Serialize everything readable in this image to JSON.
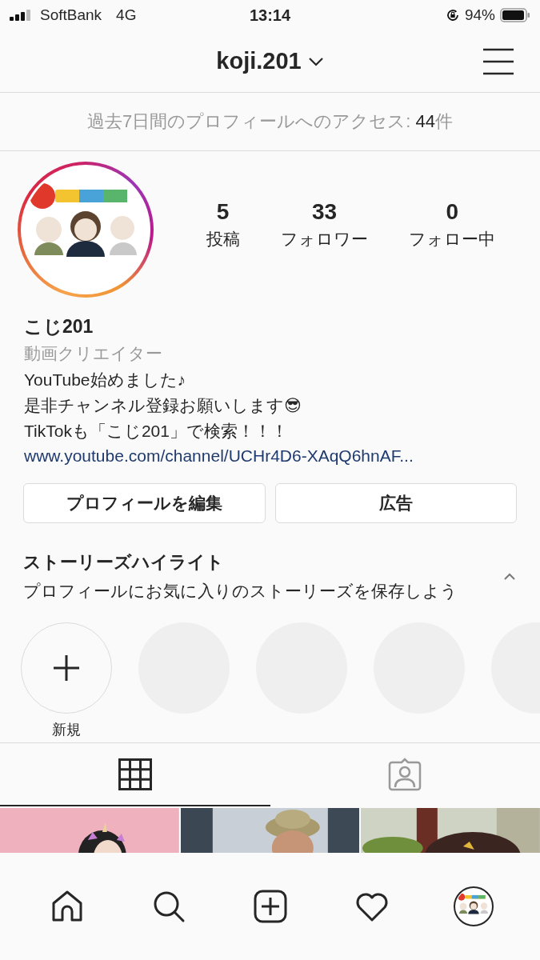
{
  "status_bar": {
    "carrier": "SoftBank",
    "network": "4G",
    "time": "13:14",
    "battery": "94%"
  },
  "header": {
    "username": "koji.201"
  },
  "access_banner": {
    "label": "過去7日間のプロフィールへのアクセス: ",
    "count": "44",
    "unit": "件"
  },
  "profile": {
    "stats": [
      {
        "value": "5",
        "label": "投稿"
      },
      {
        "value": "33",
        "label": "フォロワー"
      },
      {
        "value": "0",
        "label": "フォロー中"
      }
    ],
    "name": "こじ201",
    "category": "動画クリエイター",
    "bio": [
      "YouTube始めました♪",
      "是非チャンネル登録お願いします😎",
      "TikTokも「こじ201」で検索！！！"
    ],
    "link": "www.youtube.com/channel/UCHr4D6-XAqQ6hnAF..."
  },
  "buttons": [
    "プロフィールを編集",
    "広告"
  ],
  "highlights": {
    "title": "ストーリーズハイライト",
    "subtitle": "プロフィールにお気に入りのストーリーズを保存しよう",
    "expanded": true,
    "items": [
      {
        "kind": "new",
        "label": "新規"
      },
      {
        "kind": "empty"
      },
      {
        "kind": "empty"
      },
      {
        "kind": "empty"
      },
      {
        "kind": "empty"
      }
    ]
  },
  "tabs": [
    {
      "kind": "grid",
      "selected": true
    },
    {
      "kind": "tagged",
      "selected": false
    }
  ],
  "posts": [
    {
      "kind": "picture"
    },
    {
      "kind": "picture"
    },
    {
      "kind": "picture"
    }
  ],
  "bottom_nav": [
    {
      "kind": "home"
    },
    {
      "kind": "search"
    },
    {
      "kind": "add"
    },
    {
      "kind": "activity"
    },
    {
      "kind": "profile"
    }
  ]
}
